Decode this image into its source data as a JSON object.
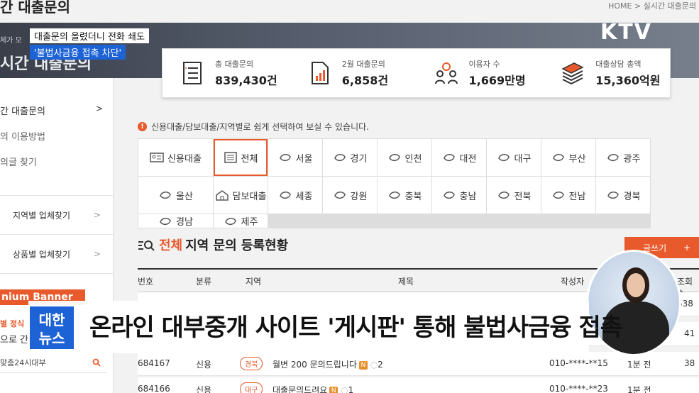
{
  "page": {
    "top_title": "간 대출문의",
    "breadcrumb": "HOME > 실시간 대출문의",
    "hero_sub": "체가 모",
    "hero_title": "시간 대출문의"
  },
  "news": {
    "caption_line1": "대출문의 올렸더니 전화 쇄도",
    "caption_line2": "'불법사금융 접촉 차단'",
    "headline": "온라인 대부중개 사이트 '게시판' 통해 불법사금융 접촉",
    "logo_line1": "대한",
    "logo_line2": "뉴스",
    "broadcaster": "KTV"
  },
  "stats": [
    {
      "label": "총 대출문의",
      "value": "839,430건",
      "icon": "document-list-icon"
    },
    {
      "label": "2월 대출문의",
      "value": "6,858건",
      "icon": "bar-chart-document-icon"
    },
    {
      "label": "이용자 수",
      "value": "1,669만명",
      "icon": "users-icon"
    },
    {
      "label": "대출상담 총액",
      "value": "15,360억원",
      "icon": "money-stack-icon"
    }
  ],
  "sidebar": {
    "link1": "간 대출문의",
    "link2": "의 이용방법",
    "link3": "의글 찾기",
    "box1": "지역별 업체찾기",
    "box2": "상품별 업체찾기",
    "premium": "nium Banner",
    "premium_sub": "별 정식",
    "premium_sub2": "으로 간",
    "search_item": "맞춤24시대부"
  },
  "notice": "신용대출/담보대출/지역별로 쉽게 선택하여 보실 수 있습니다.",
  "grid_row1": [
    "신용대출",
    "전체",
    "서울",
    "경기",
    "인천",
    "대전",
    "대구",
    "부산",
    "광주",
    "울산"
  ],
  "grid_row2": [
    "담보대출",
    "세종",
    "강원",
    "충북",
    "충남",
    "전북",
    "전남",
    "경북",
    "경남",
    "제주"
  ],
  "list": {
    "title_highlight": "전체",
    "title_rest": "지역 문의 등록현황",
    "write_label": "글쓰기",
    "write_plus": "+",
    "headers": [
      "번호",
      "분류",
      "지역",
      "제목",
      "작성자",
      "조회수"
    ],
    "rows": [
      {
        "no": "684167",
        "cat": "신용",
        "region": "경북",
        "title": "월변 200 문의드립니다",
        "comments": "2",
        "writer": "010-****-**15",
        "time": "1분 전",
        "views": "38"
      },
      {
        "no": "684166",
        "cat": "신용",
        "region": "대구",
        "title": "대출문의드려요",
        "comments": "1",
        "writer": "010-****-**23",
        "time": "1분 전",
        "views": "41"
      }
    ],
    "partial_views": [
      "538",
      "41"
    ],
    "new_badge": "N"
  }
}
